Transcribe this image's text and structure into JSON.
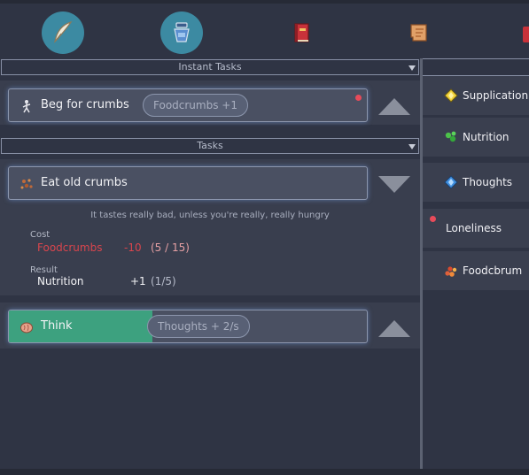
{
  "toolbar": {
    "items": [
      {
        "name": "quill-icon",
        "active": true
      },
      {
        "name": "potion-icon",
        "active": true
      },
      {
        "name": "red-book-icon",
        "active": false
      },
      {
        "name": "scroll-icon",
        "active": false
      }
    ]
  },
  "instant_tasks": {
    "header": "Instant Tasks",
    "items": [
      {
        "label": "Beg for crumbs",
        "pill": "Foodcrumbs +1",
        "icon": "beggar-icon",
        "has_notification": true
      }
    ]
  },
  "tasks": {
    "header": "Tasks",
    "items": [
      {
        "label": "Eat old crumbs",
        "icon": "crumbs-icon",
        "description": "It tastes really bad, unless you're really, really hungry",
        "cost_label": "Cost",
        "cost": {
          "name": "Foodcrumbs",
          "amount": "-10",
          "stock": "(5 / 15)"
        },
        "result_label": "Result",
        "result": {
          "name": "Nutrition",
          "amount": "+1",
          "stock": "(1/5)"
        }
      },
      {
        "label": "Think",
        "icon": "brain-icon",
        "pill": "Thoughts  + 2/s",
        "progress": 0.4
      }
    ]
  },
  "resources": [
    {
      "label": "Supplication",
      "icon": "yellow-gem-icon"
    },
    {
      "label": "Nutrition",
      "icon": "green-leaf-icon"
    },
    {
      "label": "Thoughts",
      "icon": "blue-gem-icon"
    },
    {
      "label": "Loneliness",
      "icon": "",
      "has_notification": true
    },
    {
      "label": "Foodcbrum",
      "icon": "crumbs-pile-icon"
    }
  ],
  "colors": {
    "background": "#2f3444",
    "panel": "#393e4e",
    "progress_green": "#3da17f",
    "cost_red": "#d9454d",
    "notification_red": "#e74b5a",
    "active_tool": "#3c8aa2"
  }
}
